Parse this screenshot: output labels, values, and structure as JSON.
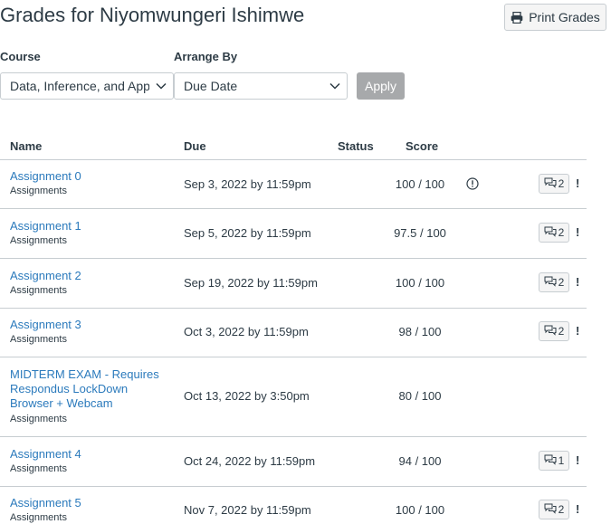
{
  "page": {
    "title": "Grades for Niyomwungeri Ishimwe",
    "print_label": "Print Grades"
  },
  "filters": {
    "course_label": "Course",
    "course_value": "Data, Inference, and Applie",
    "arrange_label": "Arrange By",
    "arrange_value": "Due Date",
    "apply_label": "Apply"
  },
  "table": {
    "headers": {
      "name": "Name",
      "due": "Due",
      "status": "Status",
      "score": "Score"
    },
    "rows": [
      {
        "name": "Assignment 0",
        "category": "Assignments",
        "due": "Sep 3, 2022 by 11:59pm",
        "score": "100 / 100",
        "comments": "2",
        "flag": "!",
        "status_icon": "warning-circle-icon"
      },
      {
        "name": "Assignment 1",
        "category": "Assignments",
        "due": "Sep 5, 2022 by 11:59pm",
        "score": "97.5 / 100",
        "comments": "2",
        "flag": "!"
      },
      {
        "name": "Assignment 2",
        "category": "Assignments",
        "due": "Sep 19, 2022 by 11:59pm",
        "score": "100 / 100",
        "comments": "2",
        "flag": "!"
      },
      {
        "name": "Assignment 3",
        "category": "Assignments",
        "due": "Oct 3, 2022 by 11:59pm",
        "score": "98 / 100",
        "comments": "2",
        "flag": "!"
      },
      {
        "name": "MIDTERM EXAM - Requires Respondus LockDown Browser + Webcam",
        "category": "Assignments",
        "due": "Oct 13, 2022 by 3:50pm",
        "score": "80 / 100"
      },
      {
        "name": "Assignment 4",
        "category": "Assignments",
        "due": "Oct 24, 2022 by 11:59pm",
        "score": "94 / 100",
        "comments": "1",
        "flag": "!"
      },
      {
        "name": "Assignment 5",
        "category": "Assignments",
        "due": "Nov 7, 2022 by 11:59pm",
        "score": "100 / 100",
        "comments": "2",
        "flag": "!"
      }
    ]
  },
  "icons": {
    "print": "printer-icon",
    "chevron": "chevron-down-icon",
    "comment": "comment-bubbles-icon",
    "status": "warning-circle-icon"
  },
  "colors": {
    "link": "#2b7abc",
    "text": "#2d3b45",
    "border": "#c7cdd1",
    "apply_disabled": "#a7a9ab"
  }
}
